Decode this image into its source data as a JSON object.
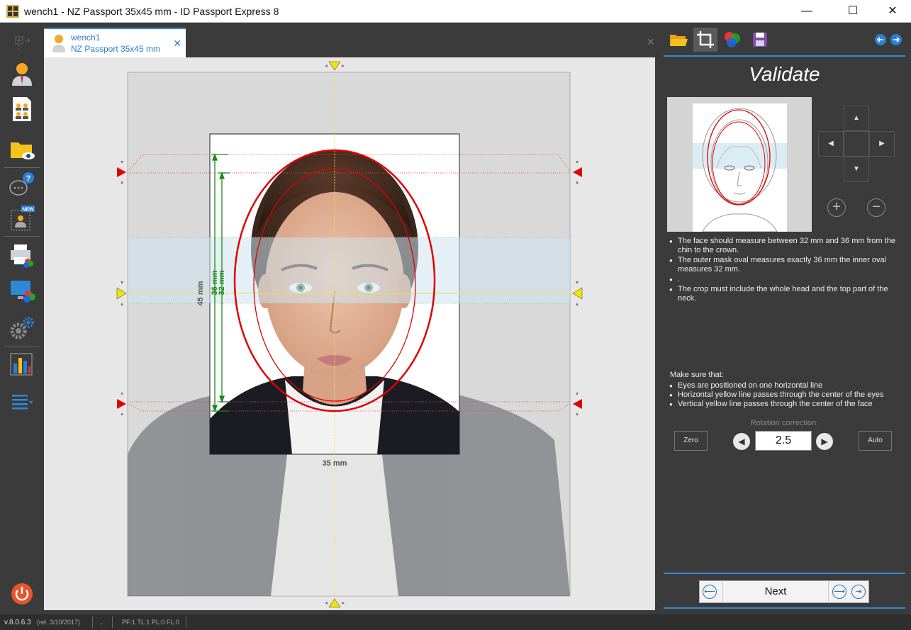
{
  "window": {
    "title": "wench1 - NZ Passport 35x45 mm - ID Passport Express 8",
    "minimize": "—",
    "maximize": "☐",
    "close": "✕"
  },
  "tab": {
    "name": "wench1",
    "spec": "NZ Passport 35x45 mm",
    "close": "✕",
    "extra_close": "✕"
  },
  "canvas": {
    "dim_width": "35 mm",
    "dim_height": "45 mm",
    "dim_outer_oval": "36 mm",
    "dim_inner_oval": "32 mm"
  },
  "panel": {
    "title": "Validate",
    "instructions": [
      "The face should measure between 32 mm and 36 mm from the chin to the crown.",
      "The outer mask oval measures exactly 36 mm the inner oval measures 32 mm.",
      ".",
      "The crop must include the whole head and the top part of the neck."
    ],
    "make_sure_title": "Make sure that:",
    "checks": [
      "Eyes are positioned on one horizontal line",
      "Horizontal yellow line passes through the center of the eyes",
      "Vertical yellow line passes through the center of the face"
    ],
    "rotation_label": "Rotation correction:",
    "rotation_value": "2.5",
    "zero_label": "Zero",
    "auto_label": "Auto",
    "next_label": "Next"
  },
  "status": {
    "version": "v.8.0.6.3",
    "release": "(rel. 3/10/2017)",
    "dots": "..",
    "flags": "PF:1 TL:1 PL:0 FL:0"
  }
}
